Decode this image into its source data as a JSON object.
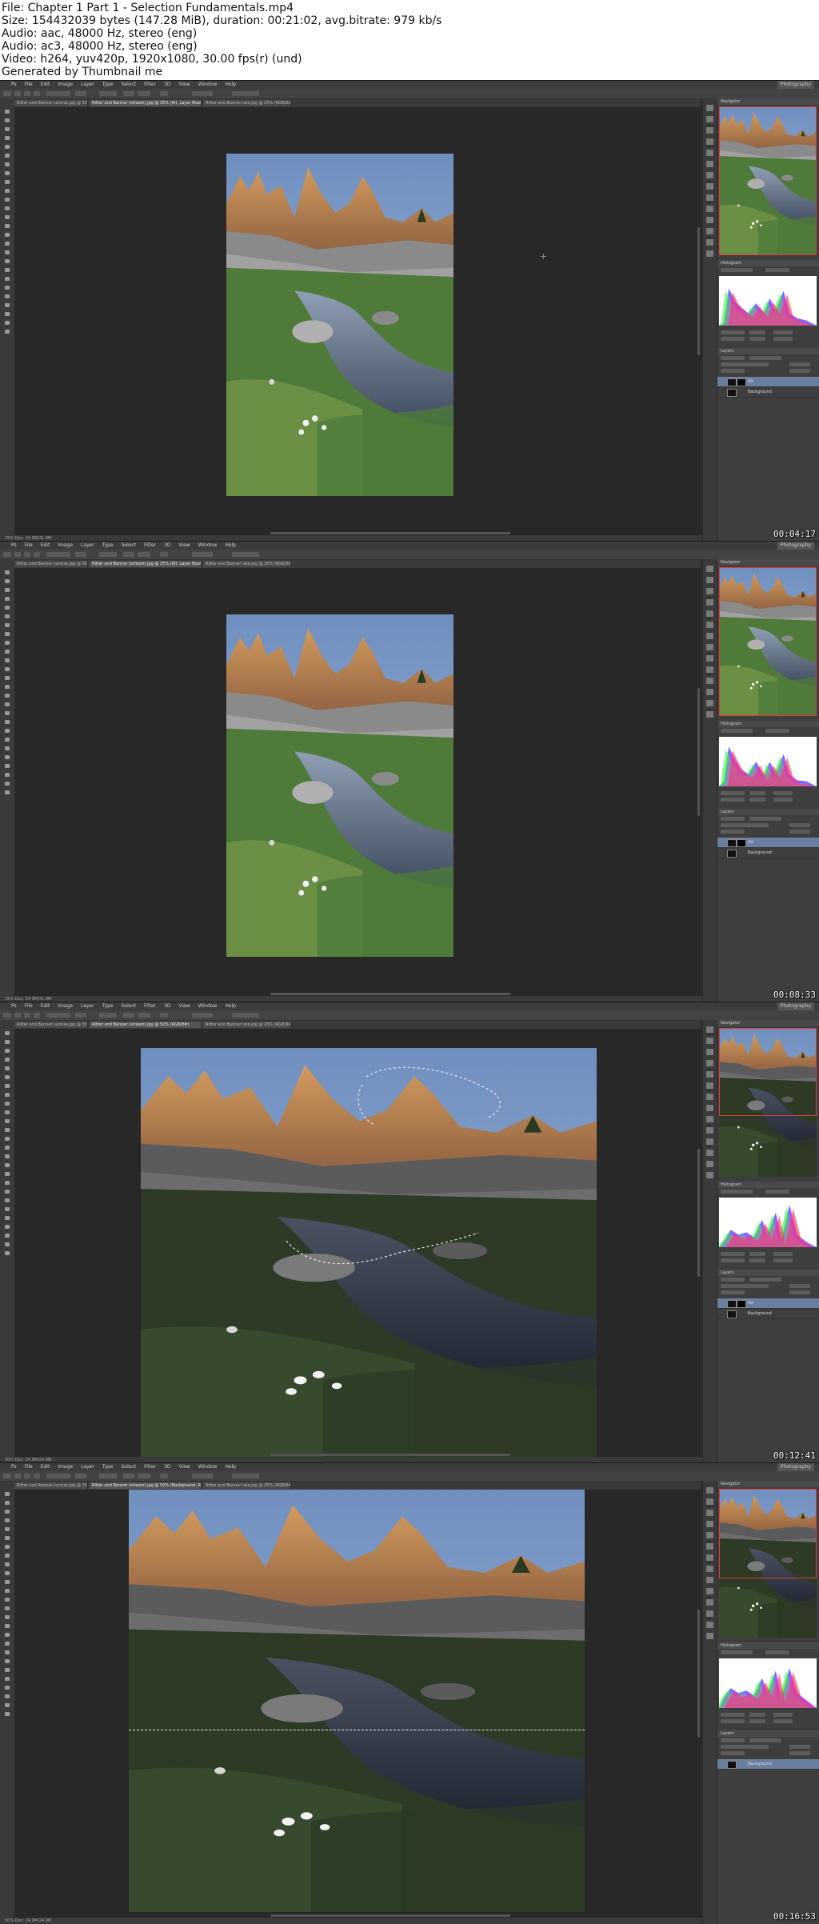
{
  "header": {
    "lines": [
      "File: Chapter 1 Part 1 - Selection Fundamentals.mp4",
      "Size: 154432039 bytes (147.28 MiB), duration: 00:21:02, avg.bitrate: 979 kb/s",
      "Audio: aac, 48000 Hz, stereo (eng)",
      "Audio: ac3, 48000 Hz, stereo (eng)",
      "Video: h264, yuv420p, 1920x1080, 30.00 fps(r) (und)",
      "Generated by Thumbnail me"
    ]
  },
  "app": {
    "menu": [
      "Ps",
      "File",
      "Edit",
      "Image",
      "Layer",
      "Type",
      "Select",
      "Filter",
      "3D",
      "View",
      "Window",
      "Help"
    ],
    "workspace": "Photography",
    "panel_tabs": {
      "navigator": "Navigator",
      "histogram": "Histogram",
      "layers": "Layers"
    },
    "layers": [
      "Alt",
      "Background"
    ]
  },
  "frames": [
    {
      "timestamp": "00:04:17",
      "tabs": [
        "Ritter and Banner sunrise.jpg @ 33.3% (RGB/8#)",
        "Ritter and Banner (stream).jpg @ 25% (Alt, Layer Mask/8)",
        "Ritter and Banner late.jpg @ 25% (RGB/8#)"
      ],
      "status": "25% Doc: 24.9M/31.9M"
    },
    {
      "timestamp": "00:08:33",
      "tabs": [
        "Ritter and Banner sunrise.jpg @ 33.3% (RGB/8#)",
        "Ritter and Banner (stream).jpg @ 25% (Alt, Layer Mask/8)",
        "Ritter and Banner late.jpg @ 25% (RGB/8#)"
      ],
      "status": "25% Doc: 24.9M/31.9M"
    },
    {
      "timestamp": "00:12:41",
      "tabs": [
        "Ritter and Banner sunrise.jpg @ 33.3% (RGB/8#)",
        "Ritter and Banner (stream).jpg @ 50% (RGB/8#)",
        "Ritter and Banner late.jpg @ 25% (RGB/8#)"
      ],
      "status": "50% Doc: 24.9M/24.9M"
    },
    {
      "timestamp": "00:16:53",
      "tabs": [
        "Ritter and Banner sunrise.jpg @ 33.3% (RGB/8#)",
        "Ritter and Banner (stream).jpg @ 50% (Background, RGB/8#)",
        "Ritter and Banner late.jpg @ 25% (RGB/8#)"
      ],
      "status": "50% Doc: 24.9M/24.9M"
    }
  ]
}
